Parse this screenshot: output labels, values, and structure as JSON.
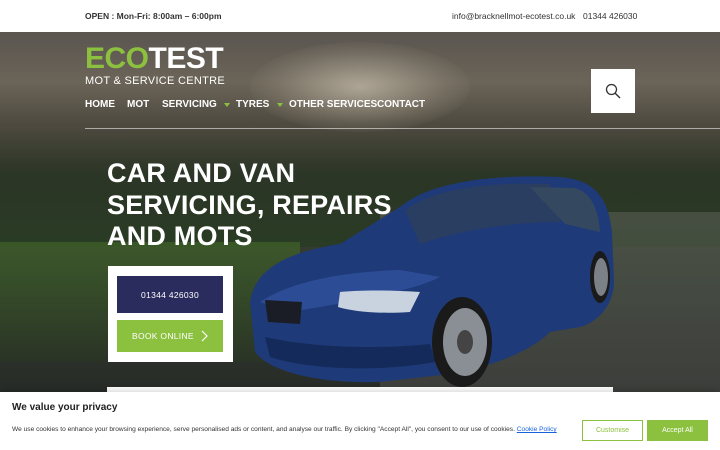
{
  "topbar": {
    "hours": "OPEN : Mon-Fri: 8:00am – 6:00pm",
    "email": "info@bracknellmot-ecotest.co.uk",
    "phone": "01344 426030"
  },
  "logo": {
    "eco": "ECO",
    "test": "TEST",
    "tagline": "MOT & SERVICE CENTRE"
  },
  "nav": {
    "items": [
      {
        "label": "HOME",
        "has_dropdown": false
      },
      {
        "label": "MOT",
        "has_dropdown": false
      },
      {
        "label": "SERVICING",
        "has_dropdown": false
      },
      {
        "label": "TYRES",
        "has_dropdown": true
      },
      {
        "label": "OTHER SERVICES",
        "has_dropdown": true
      },
      {
        "label": "CONTACT",
        "has_dropdown": false
      }
    ],
    "search_icon": "search-icon"
  },
  "hero": {
    "headline_lines": [
      "CAR AND VAN",
      "SERVICING, REPAIRS",
      "AND MOTS"
    ],
    "phone_button": "01344 426030",
    "book_button": "BOOK ONLINE"
  },
  "cookie": {
    "title": "We value your privacy",
    "message": "We use cookies to enhance your browsing experience, serve personalised ads or content, and analyse our traffic. By clicking \"Accept All\", you consent to our use of cookies.",
    "policy_link": "Cookie Policy",
    "customise": "Customise",
    "accept": "Accept All"
  },
  "colors": {
    "brand_green": "#8cc03f",
    "brand_navy": "#2b2c5e",
    "link_blue": "#1863dc"
  }
}
